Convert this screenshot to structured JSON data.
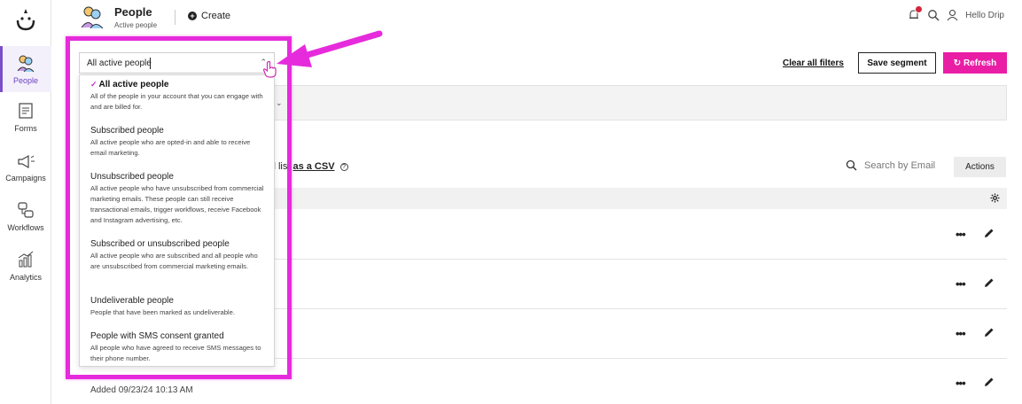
{
  "app": {
    "brand": "Drip"
  },
  "nav": {
    "items": [
      {
        "label": "People",
        "icon": "people-icon",
        "active": true
      },
      {
        "label": "Forms",
        "icon": "forms-icon",
        "active": false
      },
      {
        "label": "Campaigns",
        "icon": "megaphone-icon",
        "active": false
      },
      {
        "label": "Workflows",
        "icon": "workflow-icon",
        "active": false
      },
      {
        "label": "Analytics",
        "icon": "chart-icon",
        "active": false
      }
    ]
  },
  "header": {
    "title": "People",
    "subtitle": "Active people",
    "create_label": "Create",
    "user_label": "Hello Drip"
  },
  "toolbar": {
    "clear_filters": "Clear all filters",
    "save_segment": "Save segment",
    "refresh": "Refresh"
  },
  "segment_select": {
    "value": "All active people",
    "options": [
      {
        "title": "All active people",
        "description": "All of the people in your account that you can engage with and are billed for.",
        "selected": true
      },
      {
        "title": "Subscribed people",
        "description": "All active people who are opted-in and able to receive email marketing.",
        "selected": false
      },
      {
        "title": "Unsubscribed people",
        "description": "All active people who have unsubscribed from commercial marketing emails. These people can still receive transactional emails, trigger workflows, receive Facebook and Instagram advertising, etc.",
        "selected": false
      },
      {
        "title": "Subscribed or unsubscribed people",
        "description": "All active people who are subscribed and all people who are unsubscribed from commercial marketing emails.",
        "selected": false
      },
      {
        "title": "Undeliverable people",
        "description": "People that have been marked as undeliverable.",
        "selected": false
      },
      {
        "title": "People with SMS consent granted",
        "description": "All people who have agreed to receive SMS messages to their phone number.",
        "selected": false
      }
    ]
  },
  "export": {
    "prefix": "ll list",
    "link": "as a CSV"
  },
  "search": {
    "placeholder": "Search by Email"
  },
  "actions_label": "Actions",
  "rows": [
    {
      "email": "",
      "added": ""
    },
    {
      "email": "",
      "added": ""
    },
    {
      "email": "",
      "added": ""
    },
    {
      "email": "",
      "added": "Added 09/23/24 10:13 AM"
    }
  ],
  "colors": {
    "accent": "#e91ea5",
    "highlight": "#e62bdc",
    "nav_active": "#6b3fbf",
    "badge": "#d3253b"
  }
}
